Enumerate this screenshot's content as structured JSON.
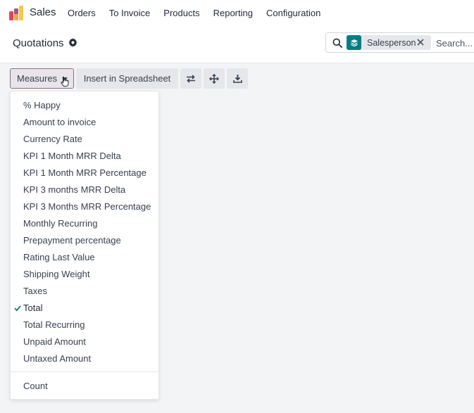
{
  "navbar": {
    "app_name": "Sales",
    "menu": [
      "Orders",
      "To Invoice",
      "Products",
      "Reporting",
      "Configuration"
    ],
    "logo_icon": "sales-app-logo"
  },
  "control_panel": {
    "title": "Quotations",
    "settings_icon": "gear-icon",
    "search": {
      "facet_label": "Salesperson",
      "facet_icon": "layers-icon",
      "placeholder": "Search..."
    }
  },
  "toolbar": {
    "measures_label": "Measures",
    "insert_label": "Insert in Spreadsheet",
    "icons": [
      "swap-axes-icon",
      "expand-all-icon",
      "download-icon"
    ]
  },
  "measures_menu": {
    "items": [
      {
        "label": "% Happy",
        "checked": false
      },
      {
        "label": "Amount to invoice",
        "checked": false
      },
      {
        "label": "Currency Rate",
        "checked": false
      },
      {
        "label": "KPI 1 Month MRR Delta",
        "checked": false
      },
      {
        "label": "KPI 1 Month MRR Percentage",
        "checked": false
      },
      {
        "label": "KPI 3 months MRR Delta",
        "checked": false
      },
      {
        "label": "KPI 3 Months MRR Percentage",
        "checked": false
      },
      {
        "label": "Monthly Recurring",
        "checked": false
      },
      {
        "label": "Prepayment percentage",
        "checked": false
      },
      {
        "label": "Rating Last Value",
        "checked": false
      },
      {
        "label": "Shipping Weight",
        "checked": false
      },
      {
        "label": "Taxes",
        "checked": false
      },
      {
        "label": "Total",
        "checked": true
      },
      {
        "label": "Total Recurring",
        "checked": false
      },
      {
        "label": "Unpaid Amount",
        "checked": false
      },
      {
        "label": "Untaxed Amount",
        "checked": false
      }
    ],
    "count_label": "Count"
  },
  "colors": {
    "accent": "#017e84",
    "measures_border": "#8b6f89",
    "background": "#f3f4f6"
  }
}
